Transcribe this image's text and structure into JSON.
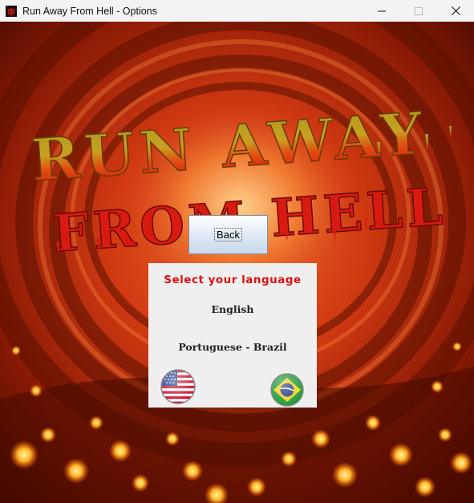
{
  "window": {
    "title": "Run Away From Hell - Options",
    "controls": {
      "minimize": "minimize",
      "maximize": "maximize",
      "close": "close"
    }
  },
  "game": {
    "logo_line1": "RUN AWAY",
    "logo_line2": "FROM HELL",
    "colors": {
      "logo_top": "#b8a020",
      "logo_bottom": "#d81010",
      "panel_title": "#e01010"
    }
  },
  "back_button": {
    "label": "Back"
  },
  "language_panel": {
    "title": "Select your language",
    "options": [
      {
        "label": "English",
        "flag": "us-flag-icon"
      },
      {
        "label": "Portuguese  - Brazil",
        "flag": "brazil-flag-icon"
      }
    ]
  }
}
